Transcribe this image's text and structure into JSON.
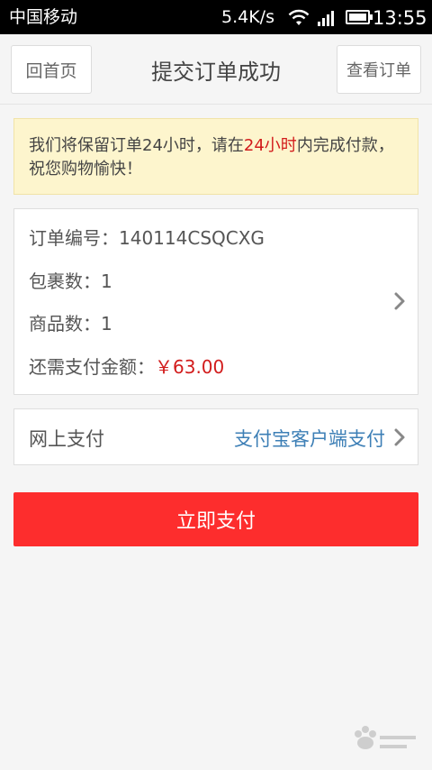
{
  "status_bar": {
    "carrier": "中国移动",
    "speed": "5.4K/s",
    "time": "13:55",
    "icons": [
      "wifi-icon",
      "signal-icon",
      "battery-icon"
    ]
  },
  "header": {
    "home_label": "回首页",
    "title": "提交订单成功",
    "orders_label": "查看订单"
  },
  "notice": {
    "text_before": "我们将保留订单24小时，请在",
    "highlight": "24小时",
    "text_after": "内完成付款，祝您购物愉快！"
  },
  "order": {
    "number_label": "订单编号：",
    "number_value": "140114CSQCXG",
    "packages_label": "包裹数：",
    "packages_value": "1",
    "items_label": "商品数：",
    "items_value": "1",
    "amount_label": "还需支付金额：",
    "amount_value": "￥63.00"
  },
  "payment": {
    "label": "网上支付",
    "method": "支付宝客户端支付"
  },
  "pay_button_label": "立即支付",
  "colors": {
    "accent_red": "#fd2d2d",
    "price_red": "#d21c1c",
    "link_blue": "#3d7fb6",
    "notice_bg": "#fdf5cd"
  }
}
